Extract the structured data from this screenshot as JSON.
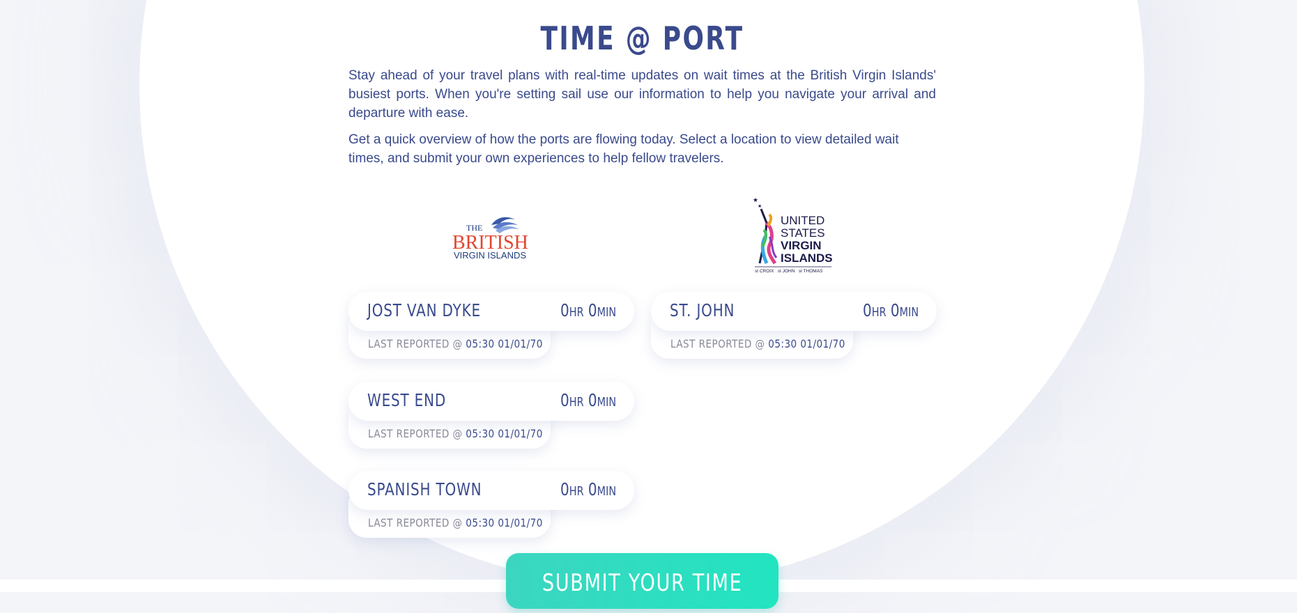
{
  "page": {
    "title": "TIME @ PORT",
    "intro_paragraph_1": "Stay ahead of your travel plans with real-time updates on wait times at the British Virgin Islands' busiest ports. When you're setting sail use our information to help you navigate your arrival and departure with ease.",
    "intro_paragraph_2": "Get a quick overview of how the ports are flowing today. Select a location to view detailed wait times, and submit your own experiences to help fellow travelers."
  },
  "logos": {
    "bvi": {
      "line1": "THE",
      "line2": "BRITISH",
      "line3": "VIRGIN ISLANDS"
    },
    "usvi": {
      "line1": "UNITED",
      "line2": "STATES",
      "line3": "VIRGIN",
      "line4": "ISLANDS",
      "footer": "st CROIX   st JOHN   st THOMAS"
    }
  },
  "ports": [
    {
      "name": "JOST VAN DYKE",
      "wait": "0hr 0min",
      "last_label": "LAST REPORTED @",
      "last_value": "05:30 01/01/70"
    },
    {
      "name": "ST. JOHN",
      "wait": "0hr 0min",
      "last_label": "LAST REPORTED @",
      "last_value": "05:30 01/01/70"
    },
    {
      "name": "WEST END",
      "wait": "0hr 0min",
      "last_label": "LAST REPORTED @",
      "last_value": "05:30 01/01/70"
    },
    {
      "name": "SPANISH TOWN",
      "wait": "0hr 0min",
      "last_label": "LAST REPORTED @",
      "last_value": "05:30 01/01/70"
    }
  ],
  "submit": {
    "label": "SUBMIT YOUR TIME"
  },
  "colors": {
    "primary_text": "#3a4a8c",
    "muted_text": "#8a8a9a",
    "accent": "#2ee0c0",
    "bvi_red": "#e2452f",
    "page_background": "#f4f5f9"
  }
}
